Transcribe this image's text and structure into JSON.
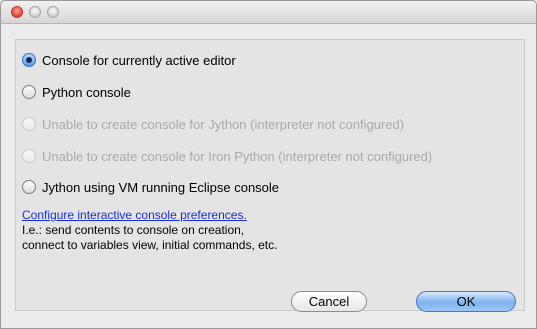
{
  "window": {
    "controls": [
      "close-icon",
      "minimize-icon",
      "zoom-icon"
    ]
  },
  "options": [
    {
      "label": "Console for currently active editor",
      "selected": true,
      "enabled": true
    },
    {
      "label": "Python console",
      "selected": false,
      "enabled": true
    },
    {
      "label": "Unable to create console for Jython (interpreter not configured)",
      "selected": false,
      "enabled": false
    },
    {
      "label": "Unable to create console for Iron Python (interpreter not configured)",
      "selected": false,
      "enabled": false
    },
    {
      "label": "Jython using VM running Eclipse console",
      "selected": false,
      "enabled": true
    }
  ],
  "preferences": {
    "link_text": "Configure interactive console preferences.",
    "description_lines": [
      "I.e.: send contents to console on creation,",
      "connect to variables view, initial commands, etc."
    ]
  },
  "buttons": {
    "cancel": "Cancel",
    "ok": "OK"
  },
  "colors": {
    "link": "#1a2fd6",
    "disabled_text": "#a9a9a9",
    "default_button": "#7fb2ee"
  }
}
